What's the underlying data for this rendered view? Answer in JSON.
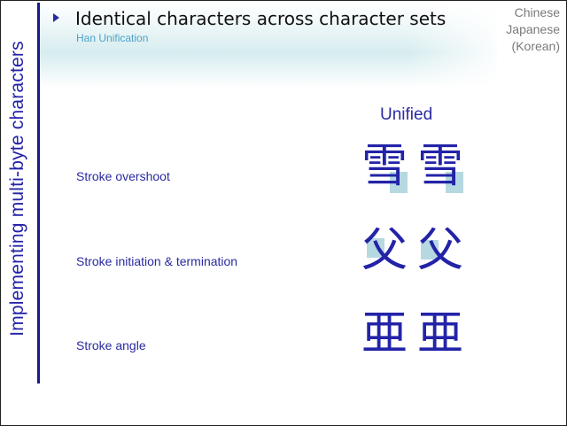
{
  "slide": {
    "side_title": "Implementing multi-byte characters",
    "title": "Identical characters across character sets",
    "subtitle": "Han Unification",
    "corner_lines": [
      "Chinese",
      "Japanese",
      "(Korean)"
    ],
    "unified_label": "Unified",
    "rows": [
      {
        "label": "Stroke overshoot",
        "chars": [
          "雪",
          "雪"
        ]
      },
      {
        "label": "Stroke initiation & termination",
        "chars": [
          "父",
          "父"
        ]
      },
      {
        "label": "Stroke angle",
        "chars": [
          "亜",
          "亜"
        ]
      }
    ]
  },
  "colors": {
    "accent": "#2a2aa0",
    "subtitle": "#4aa3c8",
    "highlight": "#a9d2dc",
    "corner_text": "#7a7a7a"
  },
  "icons": {
    "bullet": "triangle-right-icon"
  }
}
